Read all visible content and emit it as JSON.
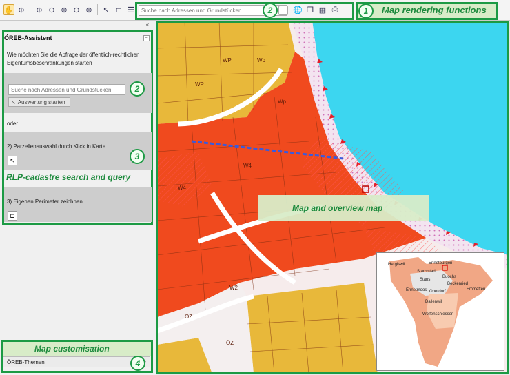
{
  "toolbar": {
    "search_placeholder": "Suche nach Adressen und Grundstücken",
    "label": "Map rendering functions",
    "badge_search": "2",
    "badge_render": "1"
  },
  "panel": {
    "title": "ÖREB-Assistent",
    "intro": "Wie möchten Sie die Abfrage der öffentlich-rechtlichen Eigentumsbeschränkungen starten",
    "search_placeholder": "Suche nach Adressen und Grundstücken",
    "eval_button": "Auswertung starten",
    "or_text": "oder",
    "option2": "2) Parzellenauswahl durch Klick in Karte",
    "option3": "3) Eigenen Perimeter zeichnen",
    "badge_search": "2",
    "badge_section": "3",
    "section_label": "RLP-cadastre search and query",
    "customisation_label": "Map customisation",
    "themes": "ÖREB-Themen",
    "badge_custom": "4"
  },
  "map": {
    "label": "Map and overview map",
    "parcels": [
      "WP",
      "WP",
      "Wp",
      "W2",
      "ÖZ",
      "ÖZ",
      "W4",
      "W4",
      "Wp"
    ]
  },
  "overview": {
    "places": [
      "Hergiswil",
      "Ennetbürgen",
      "Stansstad",
      "Buochs",
      "Stans",
      "Beckenried",
      "Ennetmoos",
      "Oberdorf",
      "Emmetten",
      "Dallenwil",
      "Wolfenschiessen"
    ]
  },
  "colors": {
    "callout_green": "#1c9a44",
    "lake": "#3cd6f0",
    "residential": "#e8b83a",
    "core_zone": "#f04a1e"
  }
}
